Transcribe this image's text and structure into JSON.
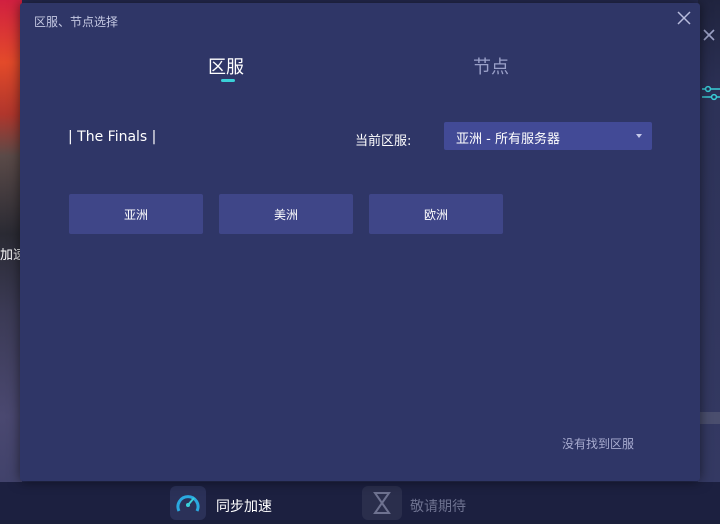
{
  "background": {
    "left_text": "加速",
    "bottom": {
      "sync_label": "同步加速",
      "wait_label": "敬请期待"
    }
  },
  "modal": {
    "title": "区服、节点选择",
    "tabs": [
      {
        "label": "区服",
        "active": true
      },
      {
        "label": "节点",
        "active": false
      }
    ],
    "game_name": "| The Finals |",
    "current_region_label": "当前区服:",
    "current_region_value": "亚洲 - 所有服务器",
    "region_buttons": [
      "亚洲",
      "美洲",
      "欧洲"
    ],
    "not_found_link": "没有找到区服"
  },
  "colors": {
    "accent": "#3ad0d8",
    "modal_bg": "#2f3667",
    "button_bg": "#3f4688",
    "select_bg": "#424a96"
  }
}
